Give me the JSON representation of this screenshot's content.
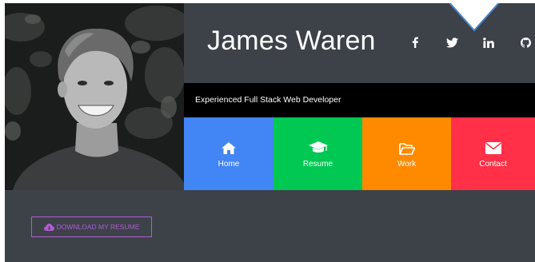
{
  "header": {
    "name": "James Waren"
  },
  "socials": [
    {
      "icon": "facebook-icon"
    },
    {
      "icon": "twitter-icon"
    },
    {
      "icon": "linkedin-icon"
    },
    {
      "icon": "github-icon"
    }
  ],
  "tagline": "Experienced Full Stack Web Developer",
  "nav": {
    "home": {
      "label": "Home",
      "icon": "home-icon",
      "color": "#4285f4"
    },
    "resume": {
      "label": "Resume",
      "icon": "graduation-cap-icon",
      "color": "#00c853"
    },
    "work": {
      "label": "Work",
      "icon": "folder-open-icon",
      "color": "#ff8a00"
    },
    "contact": {
      "label": "Contact",
      "icon": "envelope-icon",
      "color": "#ff3047"
    }
  },
  "download": {
    "label": "DOWNLOAD MY RESUME",
    "icon": "cloud-download-icon",
    "color": "#b15bd6"
  },
  "colors": {
    "background": "#3d4249",
    "tagline_bg": "#000000"
  }
}
